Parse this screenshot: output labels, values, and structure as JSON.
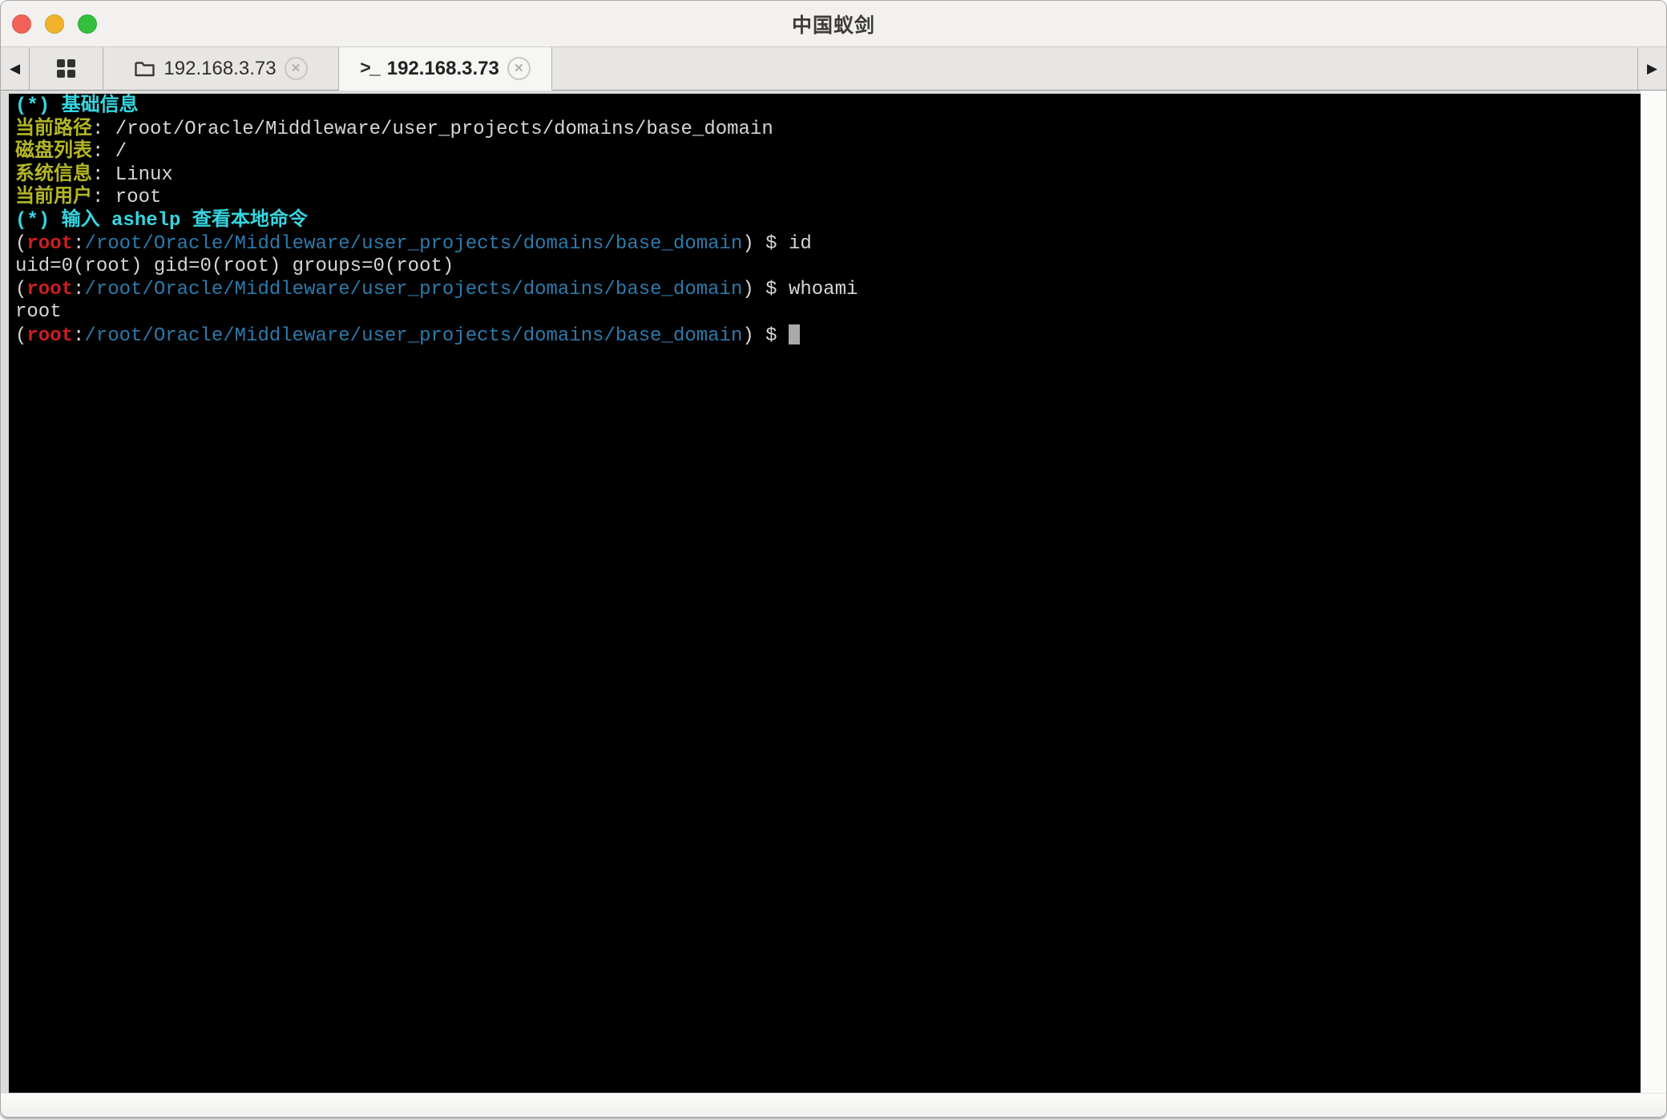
{
  "window": {
    "title": "中国蚁剑"
  },
  "colors": {
    "titlebar_bg": "#f2f1ef",
    "tabbar_bg": "#e7e6e5",
    "active_tab_bg": "#f6f6f5",
    "terminal_bg": "#000000",
    "term_white": "#d6d6d6",
    "term_cyan": "#35d6e0",
    "term_yellow": "#b4b726",
    "term_red": "#cd1f1f",
    "term_blue": "#2d7aab",
    "cursor": "#aaaaaa",
    "traffic_red": "#f3625a",
    "traffic_yellow": "#f2b32a",
    "traffic_green": "#33c03c"
  },
  "nav": {
    "back_icon": "◀",
    "forward_icon": "▶"
  },
  "tabbar": {
    "tabs": [
      {
        "label": "192.168.3.73",
        "icon": "folder-icon",
        "close_icon": "✕",
        "active": false
      },
      {
        "label": "192.168.3.73",
        "icon": "terminal-icon",
        "icon_glyph": ">_",
        "close_icon": "✕",
        "active": true
      }
    ]
  },
  "terminal": {
    "info": {
      "current_path": "/root/Oracle/Middleware/user_projects/domains/base_domain",
      "disk_list": "/",
      "system_info": "Linux",
      "current_user": "root"
    },
    "lines": [
      [
        {
          "c": "cyan",
          "t": "(*) 基础信息"
        }
      ],
      [
        {
          "c": "yellow",
          "t": "当前路径"
        },
        {
          "c": "white",
          "t": ": /root/Oracle/Middleware/user_projects/domains/base_domain"
        }
      ],
      [
        {
          "c": "yellow",
          "t": "磁盘列表"
        },
        {
          "c": "white",
          "t": ": /"
        }
      ],
      [
        {
          "c": "yellow",
          "t": "系统信息"
        },
        {
          "c": "white",
          "t": ": Linux"
        }
      ],
      [
        {
          "c": "yellow",
          "t": "当前用户"
        },
        {
          "c": "white",
          "t": ": root"
        }
      ],
      [
        {
          "c": "cyan",
          "t": "(*) 输入 ashelp 查看本地命令"
        }
      ],
      [
        {
          "c": "white",
          "t": "("
        },
        {
          "c": "red",
          "t": "root"
        },
        {
          "c": "white",
          "t": ":"
        },
        {
          "c": "blue",
          "t": "/root/Oracle/Middleware/user_projects/domains/base_domain"
        },
        {
          "c": "white",
          "t": ") $ id"
        }
      ],
      [
        {
          "c": "white",
          "t": "uid=0(root) gid=0(root) groups=0(root)"
        }
      ],
      [
        {
          "c": "white",
          "t": "("
        },
        {
          "c": "red",
          "t": "root"
        },
        {
          "c": "white",
          "t": ":"
        },
        {
          "c": "blue",
          "t": "/root/Oracle/Middleware/user_projects/domains/base_domain"
        },
        {
          "c": "white",
          "t": ") $ whoami"
        }
      ],
      [
        {
          "c": "white",
          "t": "root"
        }
      ],
      [
        {
          "c": "white",
          "t": "("
        },
        {
          "c": "red",
          "t": "root"
        },
        {
          "c": "white",
          "t": ":"
        },
        {
          "c": "blue",
          "t": "/root/Oracle/Middleware/user_projects/domains/base_domain"
        },
        {
          "c": "white",
          "t": ") $ "
        },
        {
          "c": "cursor"
        }
      ]
    ]
  }
}
